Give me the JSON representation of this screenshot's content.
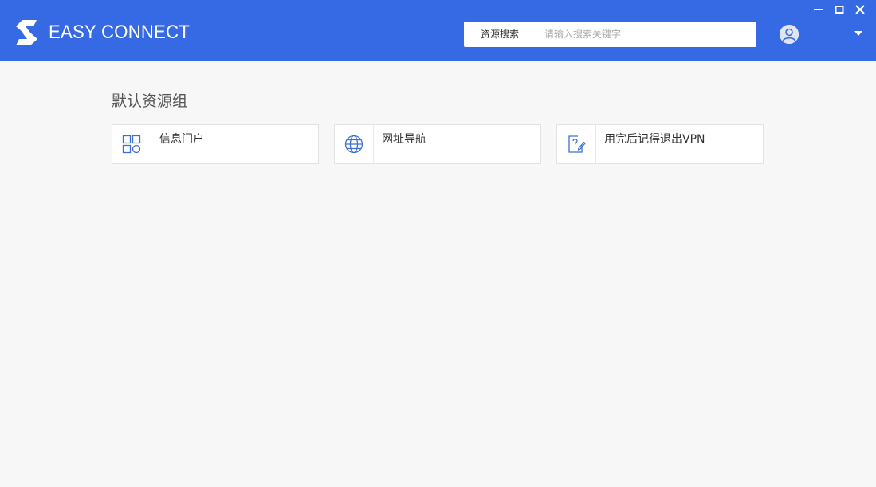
{
  "header": {
    "brand": "EASY CONNECT",
    "search": {
      "scope_label": "资源搜索",
      "placeholder": "请输入搜索关键字",
      "value": ""
    },
    "accent_color": "#3669e4"
  },
  "window_controls": [
    "minimize-icon",
    "maximize-icon",
    "close-icon"
  ],
  "main": {
    "group_title": "默认资源组",
    "resources": [
      {
        "label": "信息门户",
        "icon": "grid-apps-icon"
      },
      {
        "label": "网址导航",
        "icon": "globe-icon"
      },
      {
        "label": "用完后记得退出VPN",
        "icon": "help-document-icon"
      }
    ]
  }
}
